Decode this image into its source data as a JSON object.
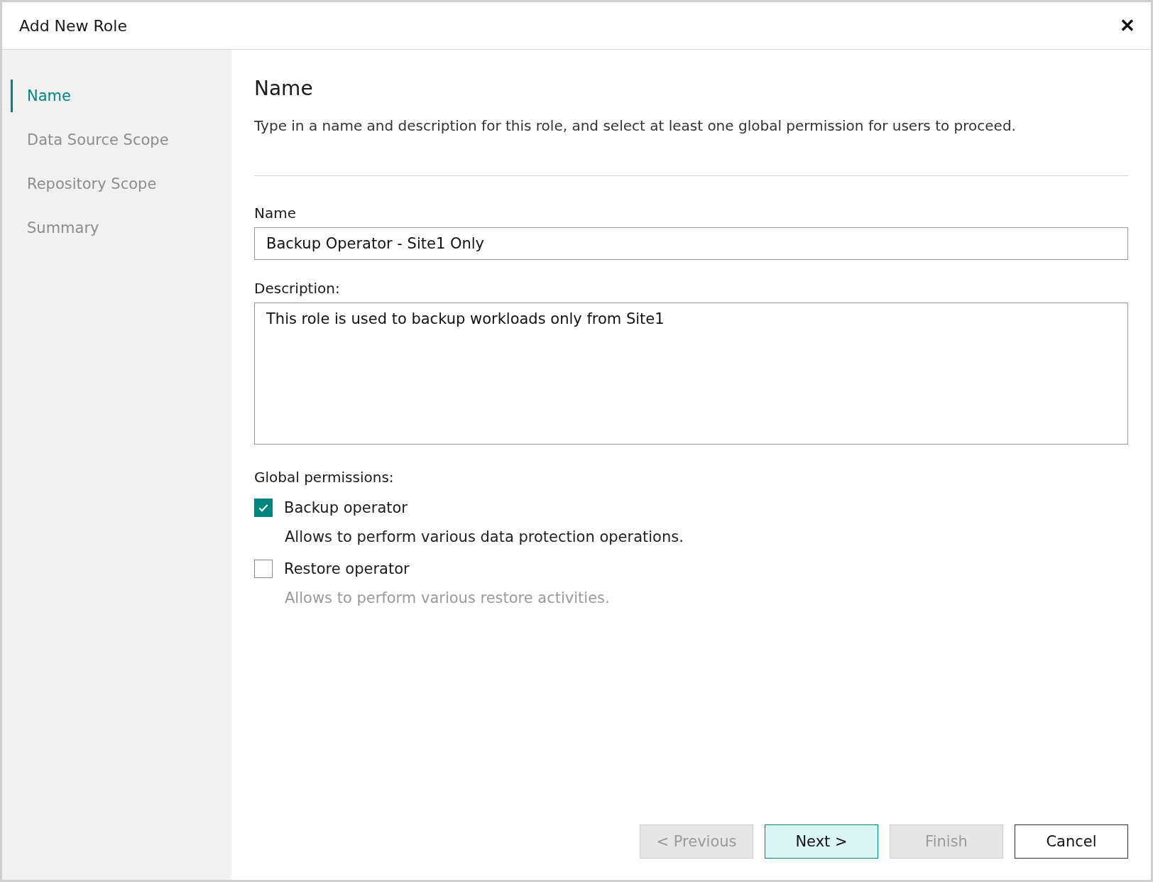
{
  "window": {
    "title": "Add New Role",
    "close": "✕"
  },
  "sidebar": {
    "items": [
      {
        "label": "Name",
        "selected": true
      },
      {
        "label": "Data Source Scope",
        "selected": false
      },
      {
        "label": "Repository Scope",
        "selected": false
      },
      {
        "label": "Summary",
        "selected": false
      }
    ]
  },
  "content": {
    "heading": "Name",
    "description": "Type in a name and description for this role, and select at least one global permission for users to proceed.",
    "name_field": {
      "label": "Name",
      "value": "Backup Operator - Site1 Only"
    },
    "description_field": {
      "label": "Description:",
      "value": "This role is used to backup workloads only from Site1"
    },
    "permissions_label": "Global permissions:",
    "permissions": [
      {
        "label": "Backup operator",
        "checked": true,
        "description": "Allows to perform various data protection operations."
      },
      {
        "label": "Restore operator",
        "checked": false,
        "description": "Allows to perform various restore activities."
      }
    ]
  },
  "buttons": [
    {
      "label": "< Previous",
      "disabled": true,
      "default": false
    },
    {
      "label": "Next >",
      "disabled": false,
      "default": true
    },
    {
      "label": "Finish",
      "disabled": true,
      "default": false
    },
    {
      "label": "Cancel",
      "disabled": false,
      "default": false
    }
  ]
}
